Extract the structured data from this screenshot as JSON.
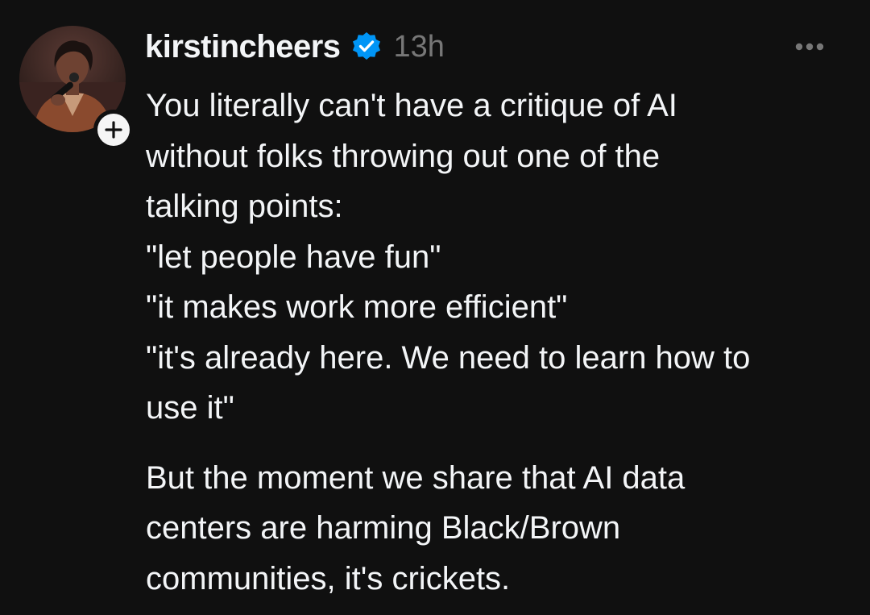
{
  "post": {
    "author": {
      "username": "kirstincheers",
      "verified": true,
      "timestamp": "13h",
      "avatar": "profile-photo",
      "follow_icon": "plus-icon"
    },
    "more_icon": "more-horizontal-icon",
    "body": {
      "paragraph1": [
        "You literally can't have a critique of AI",
        "without folks throwing out one of the",
        "talking points:",
        "\"let people have fun\"",
        "\"it makes work more efficient\"",
        "\"it's already here. We need to learn how to",
        "use it\""
      ],
      "paragraph2": [
        "But the moment we share that AI data",
        "centers are harming Black/Brown",
        "communities, it's crickets."
      ]
    },
    "colors": {
      "background": "#101010",
      "text": "#f3f5f7",
      "muted": "#777777",
      "verified_badge": "#0095f6"
    }
  }
}
